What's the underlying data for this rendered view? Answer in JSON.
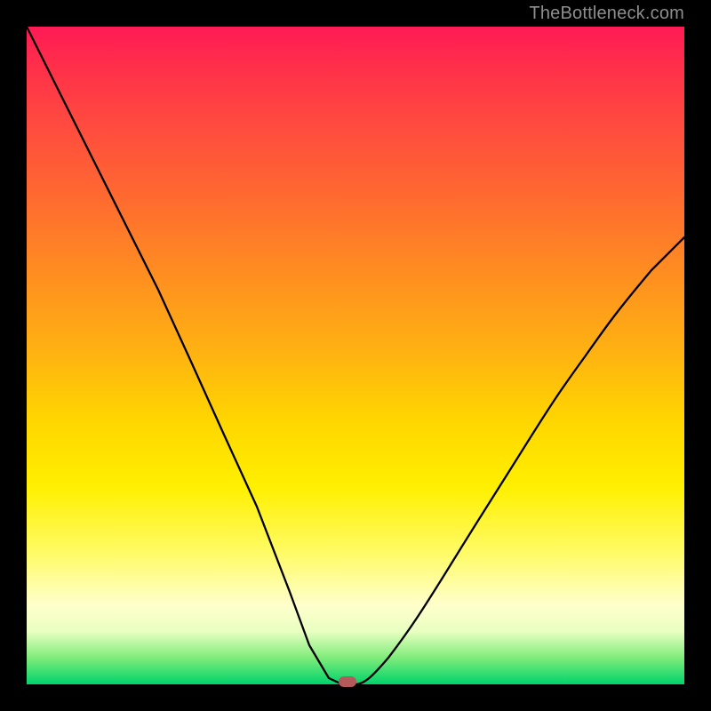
{
  "watermark": "TheBottleneck.com",
  "chart_data": {
    "type": "line",
    "title": "",
    "xlabel": "",
    "ylabel": "",
    "xlim": [
      0,
      1
    ],
    "ylim": [
      0,
      1
    ],
    "series": [
      {
        "name": "curve",
        "x": [
          0.0,
          0.05,
          0.1,
          0.15,
          0.2,
          0.25,
          0.3,
          0.35,
          0.4,
          0.43,
          0.46,
          0.48,
          0.5,
          0.55,
          0.6,
          0.65,
          0.7,
          0.75,
          0.8,
          0.85,
          0.9,
          0.95,
          1.0
        ],
        "values": [
          1.0,
          0.9,
          0.8,
          0.7,
          0.6,
          0.49,
          0.38,
          0.27,
          0.14,
          0.06,
          0.01,
          0.0,
          0.0,
          0.04,
          0.11,
          0.19,
          0.27,
          0.35,
          0.43,
          0.5,
          0.57,
          0.63,
          0.68
        ]
      }
    ],
    "marker": {
      "x": 0.485,
      "y": 0.0
    },
    "background_gradient": {
      "stops": [
        {
          "pos": 0.0,
          "color": "#ff1a55"
        },
        {
          "pos": 0.5,
          "color": "#ffb411"
        },
        {
          "pos": 0.7,
          "color": "#fff000"
        },
        {
          "pos": 0.92,
          "color": "#e8ffc0"
        },
        {
          "pos": 1.0,
          "color": "#00d36b"
        }
      ]
    }
  }
}
